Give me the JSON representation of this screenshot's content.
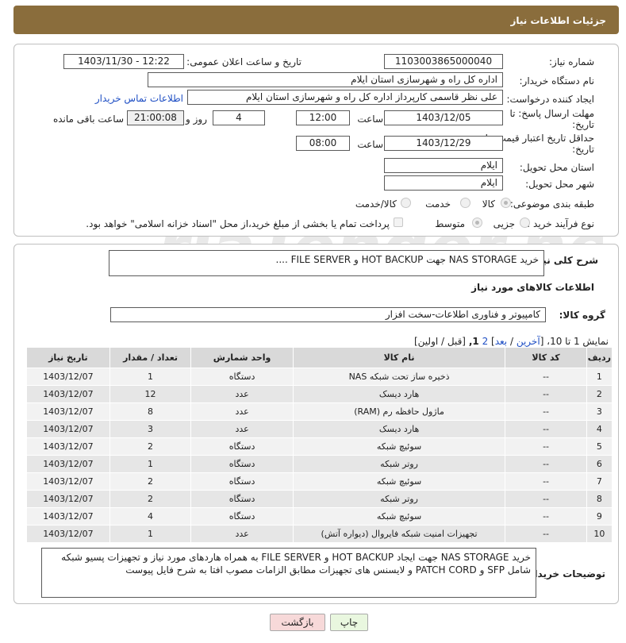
{
  "header": {
    "title": "جزئیات اطلاعات نیاز"
  },
  "fields": {
    "need_number_label": "شماره نیاز:",
    "need_number": "1103003865000040",
    "announce_label": "تاریخ و ساعت اعلان عمومی:",
    "announce_value": "1403/11/30 - 12:22",
    "buyer_org_label": "نام دستگاه خریدار:",
    "buyer_org": "اداره کل راه و شهرسازی استان ایلام",
    "requester_label": "ایجاد کننده درخواست:",
    "requester": "علی نظر قاسمی کارپرداز اداره کل راه و شهرسازی استان ایلام",
    "contact_link": "اطلاعات تماس خریدار",
    "deadline_label_1": "مهلت ارسال پاسخ: تا",
    "deadline_label_2": "تاریخ:",
    "deadline_date": "1403/12/05",
    "time_word": "ساعت",
    "deadline_time": "12:00",
    "days_value": "4",
    "days_word": "روز و",
    "remaining_time": "21:00:08",
    "remaining_word": "ساعت باقی مانده",
    "validity_label_1": "حداقل تاریخ اعتبار قیمت: تا",
    "validity_label_2": "تاریخ:",
    "validity_date": "1403/12/29",
    "validity_time": "08:00",
    "province_label": "استان محل تحویل:",
    "province": "ایلام",
    "city_label": "شهر محل تحویل:",
    "city": "ایلام",
    "category_label": "طبقه بندی موضوعی:",
    "category_options": [
      "کالا",
      "خدمت",
      "کالا/خدمت"
    ],
    "process_label": "نوع فرآیند خرید :",
    "process_options": [
      "جزیی",
      "متوسط"
    ],
    "payment_note": "پرداخت تمام یا بخشی از مبلغ خرید،از محل \"اسناد خزانه اسلامی\" خواهد بود."
  },
  "details": {
    "summary_label": "شرح کلی نیاز:",
    "summary_value": "خرید NAS STORAGE جهت HOT BACKUP و FILE SERVER ....",
    "goods_info_title": "اطلاعات کالاهای مورد نیاز",
    "group_label": "گروه کالا:",
    "group_value": "کامپیوتر و فناوری اطلاعات-سخت افزار",
    "paging_text": "نمایش 1 تا 10، [",
    "paging_last": "آخرین",
    "paging_sep": " / ",
    "paging_next": "بعد",
    "paging_page2": "2",
    "paging_page1": "1,",
    "paging_tail": "[قبل / اولین]"
  },
  "table": {
    "columns": [
      "ردیف",
      "کد کالا",
      "نام کالا",
      "واحد شمارش",
      "تعداد / مقدار",
      "تاریخ نیاز"
    ],
    "rows": [
      [
        "1",
        "--",
        "ذخیره ساز تحت شبکه NAS",
        "دستگاه",
        "1",
        "1403/12/07"
      ],
      [
        "2",
        "--",
        "هارد دیسک",
        "عدد",
        "12",
        "1403/12/07"
      ],
      [
        "3",
        "--",
        "ماژول حافظه رم (RAM)",
        "عدد",
        "8",
        "1403/12/07"
      ],
      [
        "4",
        "--",
        "هارد دیسک",
        "عدد",
        "3",
        "1403/12/07"
      ],
      [
        "5",
        "--",
        "سوئیچ شبکه",
        "دستگاه",
        "2",
        "1403/12/07"
      ],
      [
        "6",
        "--",
        "روتر شبکه",
        "دستگاه",
        "1",
        "1403/12/07"
      ],
      [
        "7",
        "--",
        "سوئیچ شبکه",
        "دستگاه",
        "2",
        "1403/12/07"
      ],
      [
        "8",
        "--",
        "روتر شبکه",
        "دستگاه",
        "2",
        "1403/12/07"
      ],
      [
        "9",
        "--",
        "سوئیچ شبکه",
        "دستگاه",
        "4",
        "1403/12/07"
      ],
      [
        "10",
        "--",
        "تجهیزات امنیت شبکه فایروال (دیواره آتش)",
        "عدد",
        "1",
        "1403/12/07"
      ]
    ]
  },
  "buyer_notes": {
    "label": "توضیحات خریدار:",
    "text": "خرید NAS STORAGE جهت ایجاد HOT BACKUP و FILE SERVER به همراه هاردهای مورد نیاز و تجهیزات پسیو شبکه شامل SFP و PATCH CORD و لایسنس های تجهیزات مطابق الزامات مصوب افتا به شرح فایل پیوست"
  },
  "buttons": {
    "print": "چاپ",
    "back": "بازگشت"
  },
  "watermark": "AriaTender.neT",
  "colors": {
    "header": "#8a6d3c",
    "link": "#1f4fc4",
    "back_button": "#f7d9d9",
    "print_button": "#e9f7df"
  }
}
